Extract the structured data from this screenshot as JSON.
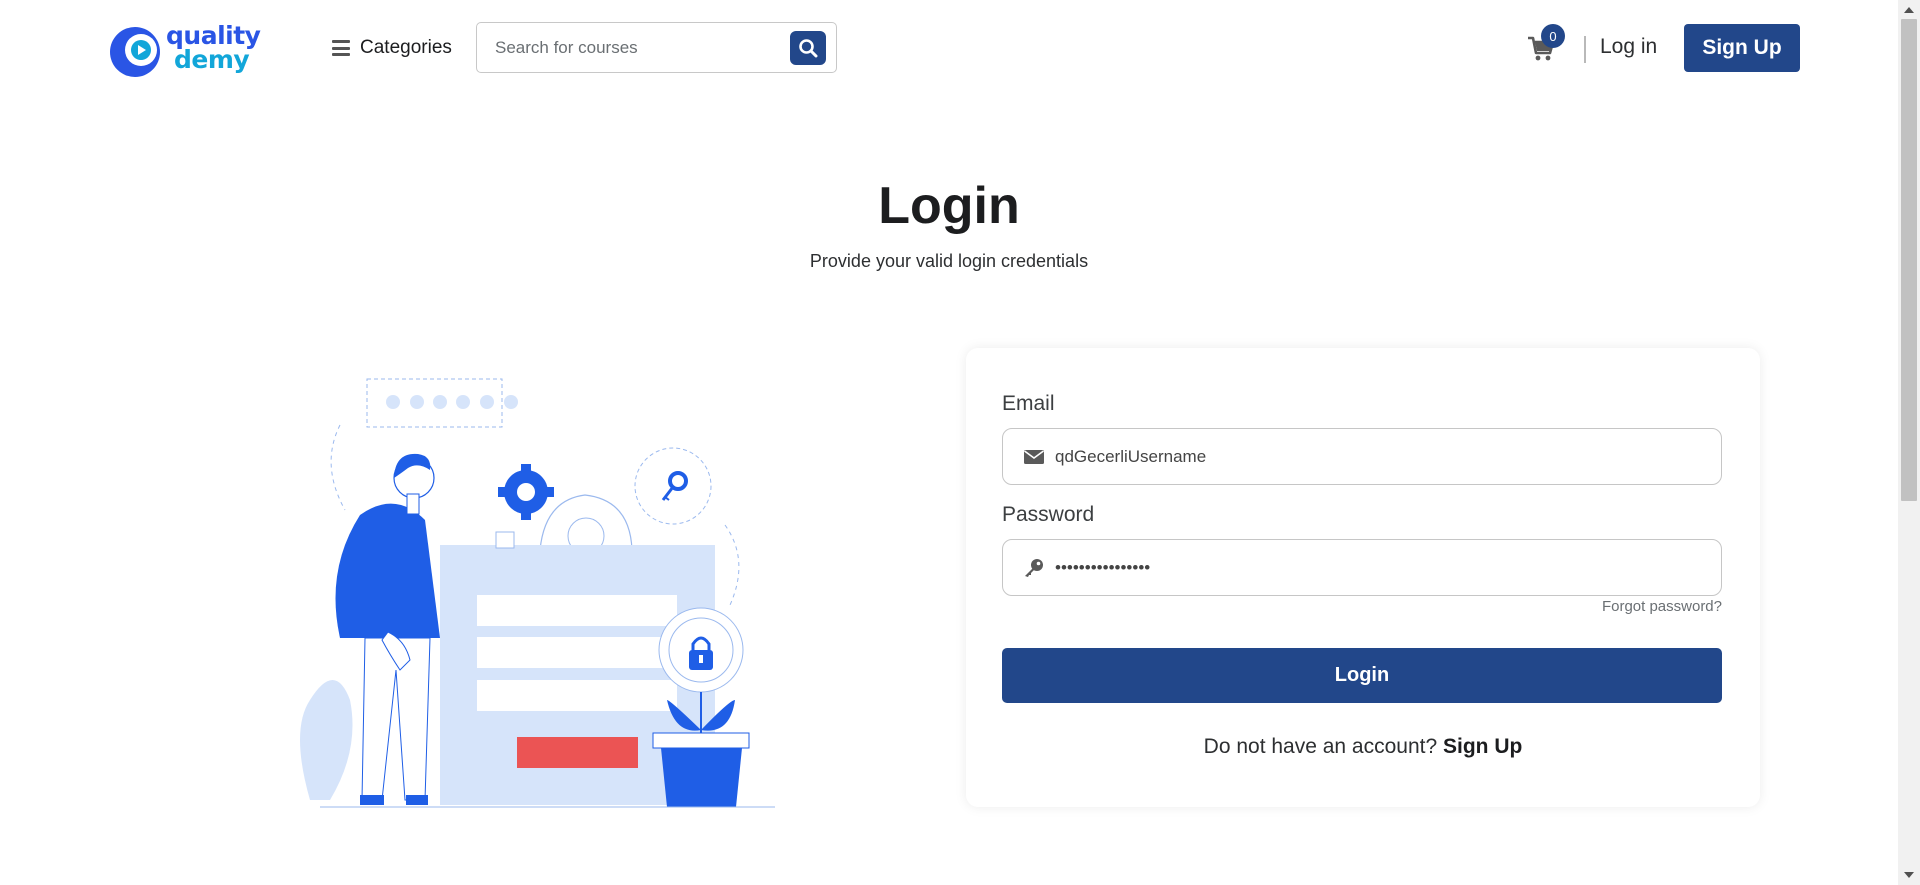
{
  "header": {
    "logo_line1": "quality",
    "logo_line2": "demy",
    "categories_label": "Categories",
    "search_placeholder": "Search for courses",
    "cart_count": "0",
    "login_label": "Log in",
    "signup_label": "Sign Up"
  },
  "page": {
    "title": "Login",
    "subtitle": "Provide your valid login credentials"
  },
  "form": {
    "email_label": "Email",
    "email_value": "qdGecerliUsername",
    "password_label": "Password",
    "password_value": "••••••••••••••••",
    "forgot_label": "Forgot password?",
    "login_button": "Login",
    "no_account_text": "Do not have an account?",
    "signup_link": "Sign Up"
  },
  "icons": {
    "search": "search-icon",
    "cart": "cart-icon",
    "menu": "hamburger-icon",
    "email": "envelope-icon",
    "password": "key-icon"
  },
  "colors": {
    "primary": "#22478a",
    "brand_blue": "#2a55e5",
    "brand_cyan": "#12a6d9",
    "illustration_blue": "#1f5ee6",
    "illustration_light": "#d6e4fa",
    "illustration_red": "#eb5454"
  }
}
